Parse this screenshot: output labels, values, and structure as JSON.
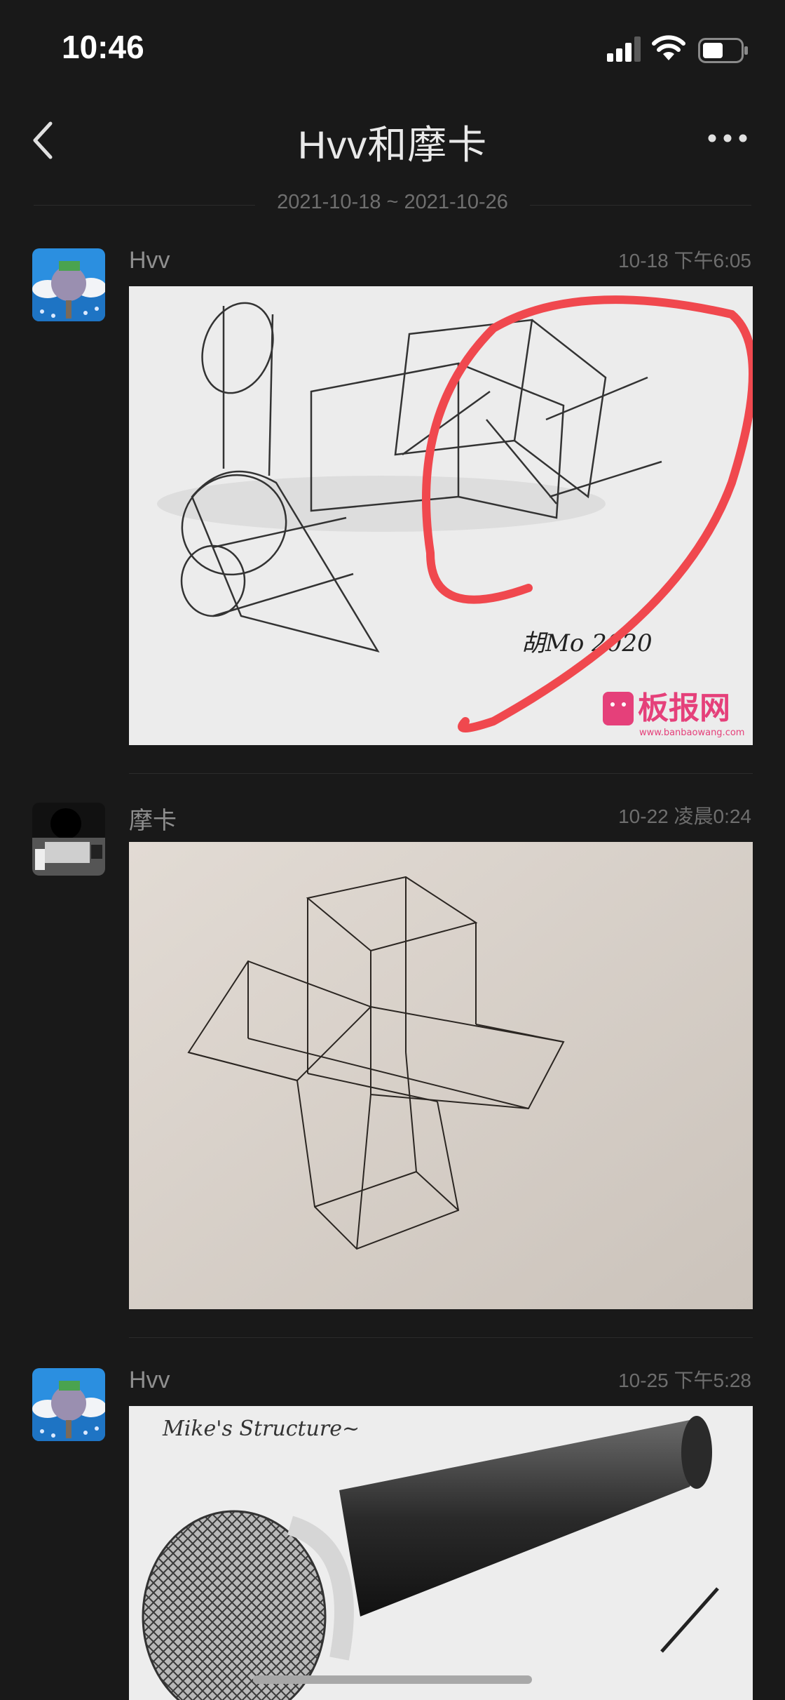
{
  "status_bar": {
    "time": "10:46",
    "icons": [
      "cellular-signal-icon",
      "wifi-icon",
      "battery-icon"
    ]
  },
  "nav": {
    "title": "Hvv和摩卡",
    "back_icon": "chevron-left-icon",
    "more_icon": "more-dots-icon"
  },
  "date_range": "2021-10-18 ~ 2021-10-26",
  "messages": [
    {
      "sender": "Hvv",
      "time": "10-18 下午6:05",
      "image_watermark": "板报网",
      "image_watermark_url": "www.banbaowang.com",
      "image_signature": "胡Mo 2020"
    },
    {
      "sender": "摩卡",
      "time": "10-22 凌晨0:24"
    },
    {
      "sender": "Hvv",
      "time": "10-25 下午5:28",
      "image_caption": "Mike's Structure~"
    }
  ],
  "colors": {
    "background": "#191919",
    "annotation_red": "#f0484e",
    "watermark_pink": "#e5407a"
  }
}
